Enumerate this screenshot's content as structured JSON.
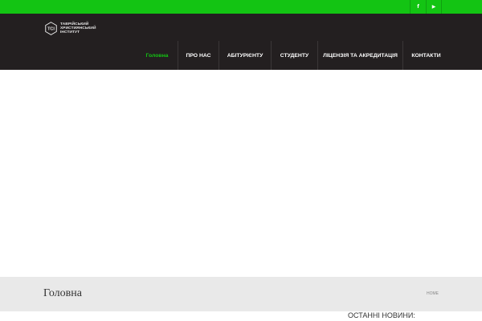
{
  "topbar": {
    "social": [
      {
        "icon": "facebook-icon",
        "glyph": "f"
      },
      {
        "icon": "youtube-icon",
        "glyph": "▶"
      }
    ]
  },
  "logo": {
    "line1": "ТАВРІЙСЬКИЙ",
    "line2": "ХРИСТИЯНСЬКИЙ",
    "line3": "ІНСТИТУТ"
  },
  "nav": {
    "items": [
      {
        "label": "Головна",
        "active": true
      },
      {
        "label": "ПРО НАС"
      },
      {
        "label": "АБІТУРІЄНТУ"
      },
      {
        "label": "СТУДЕНТУ"
      },
      {
        "label": "ЛІЦЕНЗІЯ ТА АКРЕДИТАЦІЯ"
      },
      {
        "label": "КОНТАКТИ"
      }
    ]
  },
  "titlebar": {
    "title": "Головна",
    "breadcrumb": "HOME"
  },
  "sidebar": {
    "news_heading": "ОСТАННІ НОВИНИ:"
  },
  "colors": {
    "accent": "#13c413",
    "header_bg": "#231f20",
    "titlebar_bg": "#e9e9e9"
  }
}
